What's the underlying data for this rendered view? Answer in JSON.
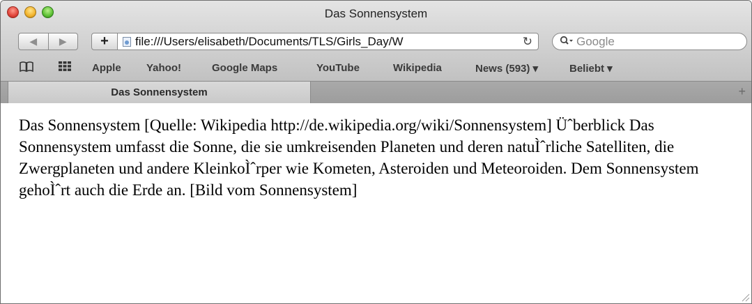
{
  "window": {
    "title": "Das Sonnensystem"
  },
  "toolbar": {
    "back_label": "◀",
    "forward_label": "▶",
    "add_label": "+",
    "url": "file:///Users/elisabeth/Documents/TLS/Girls_Day/W",
    "reload_label": "↻",
    "search_placeholder": "Google"
  },
  "bookmarks": {
    "items": [
      {
        "label": "Apple"
      },
      {
        "label": "Yahoo!"
      },
      {
        "label": "Google Maps"
      },
      {
        "label": "YouTube"
      },
      {
        "label": "Wikipedia"
      },
      {
        "label": "News (593) ▾"
      },
      {
        "label": "Beliebt ▾"
      }
    ]
  },
  "tabs": {
    "active_label": "Das Sonnensystem",
    "add_label": "+"
  },
  "page": {
    "text": "Das Sonnensystem [Quelle: Wikipedia http://de.wikipedia.org/wiki/Sonnensystem] Üˆberblick Das Sonnensystem umfasst die Sonne, die sie umkreisenden Planeten und deren natuÌˆrliche Satelliten, die Zwergplaneten und andere KleinkoÌˆrper wie Kometen, Asteroiden und Meteoroiden. Dem Sonnensystem gehoÌˆrt auch die Erde an. [Bild vom Sonnensystem]"
  }
}
